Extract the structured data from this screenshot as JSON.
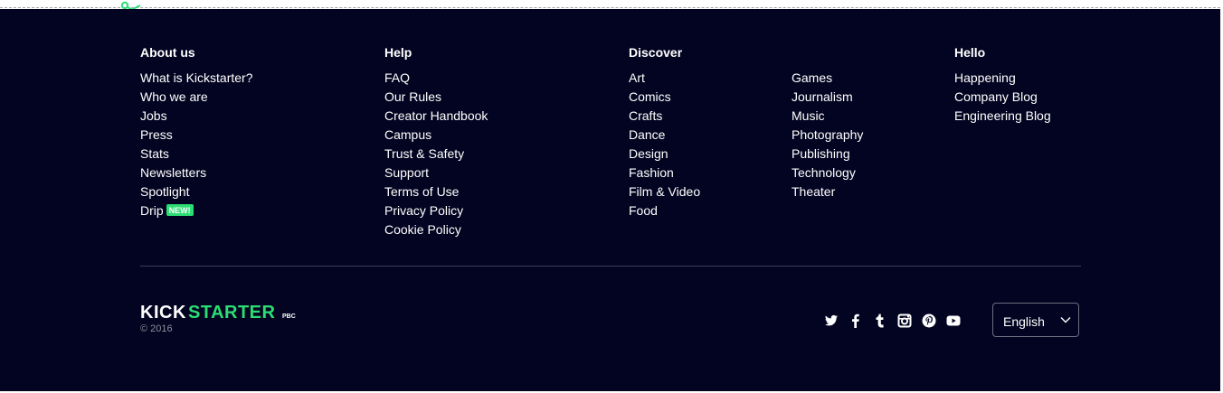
{
  "columns": {
    "about": {
      "heading": "About us",
      "items": [
        "What is Kickstarter?",
        "Who we are",
        "Jobs",
        "Press",
        "Stats",
        "Newsletters",
        "Spotlight",
        "Drip"
      ],
      "new_badge": "NEW!"
    },
    "help": {
      "heading": "Help",
      "items": [
        "FAQ",
        "Our Rules",
        "Creator Handbook",
        "Campus",
        "Trust & Safety",
        "Support",
        "Terms of Use",
        "Privacy Policy",
        "Cookie Policy"
      ]
    },
    "discover": {
      "heading": "Discover",
      "items_left": [
        "Art",
        "Comics",
        "Crafts",
        "Dance",
        "Design",
        "Fashion",
        "Film & Video",
        "Food"
      ],
      "items_right": [
        "Games",
        "Journalism",
        "Music",
        "Photography",
        "Publishing",
        "Technology",
        "Theater"
      ]
    },
    "hello": {
      "heading": "Hello",
      "items": [
        "Happening",
        "Company Blog",
        "Engineering Blog"
      ]
    }
  },
  "brand": {
    "logo_kick": "KICK",
    "logo_starter": "STARTER",
    "logo_suffix": "PBC",
    "copyright": "© 2016",
    "accent": "#2bde73"
  },
  "social": [
    "twitter-icon",
    "facebook-icon",
    "tumblr-icon",
    "instagram-icon",
    "pinterest-icon",
    "youtube-icon"
  ],
  "language": {
    "selected": "English"
  },
  "colors": {
    "background": "#030421",
    "text": "#ffffff",
    "muted": "#8c8e99"
  }
}
